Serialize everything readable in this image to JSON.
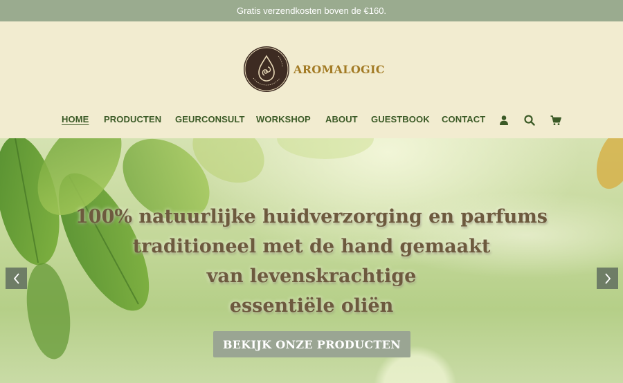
{
  "announcement": "Gratis verzendkosten boven de €160.",
  "brand": {
    "name": "AROMALOGIC",
    "badge_text": "AROMALOGIC AMSTERDAM",
    "colors": {
      "badge": "#3d2b22",
      "name": "#a37b25"
    }
  },
  "nav": {
    "items": [
      {
        "label": "HOME",
        "active": true
      },
      {
        "label": "PRODUCTEN"
      },
      {
        "label": "GEURCONSULT"
      },
      {
        "label": "WORKSHOP"
      },
      {
        "label": "ABOUT"
      },
      {
        "label": "GUESTBOOK"
      },
      {
        "label": "CONTACT"
      }
    ],
    "icons": [
      "account-icon",
      "search-icon",
      "cart-icon"
    ]
  },
  "hero": {
    "lines": [
      "100% natuurlijke huidverzorging en parfums",
      "traditioneel met de hand gemaakt",
      "van levenskrachtige",
      "essentiële oliën"
    ],
    "button_label": "BEKIJK ONZE PRODUCTEN",
    "prev_icon": "chevron-left-icon",
    "next_icon": "chevron-right-icon"
  },
  "colors": {
    "announcement_bg": "#9aab8f",
    "header_bg": "#f2ecd0",
    "nav_text": "#3b5a26",
    "hero_text": "#6d5a3e",
    "button_bg": "#9aa593",
    "arrow_bg": "#6e7d66"
  }
}
